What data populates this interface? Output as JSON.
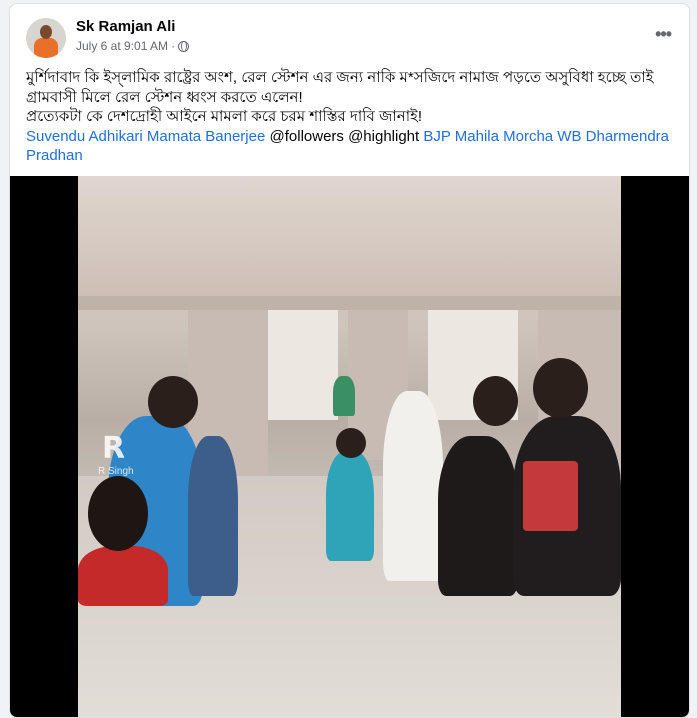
{
  "post": {
    "author": "Sk Ramjan Ali",
    "timestamp": "July 6 at 9:01 AM",
    "separator": "·",
    "privacy_icon": "globe-icon",
    "more_icon": "more-options-icon",
    "text_lines": [
      "মুর্শিদাবাদ কি ইস্‌লামিক রাষ্ট্রের অংশ,  রেল স্টেশন এর জন্য নাকি ম*সজিদে নামাজ পড়তে অসুবিধা হচ্ছে তাই গ্রামবাসী মিলে রেল স্টেশন ধ্বংস করতে এলেন!",
      "প্রত্যেকটা কে দেশদ্রোহী আইনে মামলা করে চরম শাস্তির দাবি জানাই!"
    ],
    "tags": {
      "t1": "Suvendu Adhikari",
      "t2": "Mamata Banerjee",
      "t3": "@followers @highlight",
      "t4": "BJP Mahila Morcha WB",
      "t5": "Dharmendra Pradhan"
    }
  },
  "video": {
    "watermark": "R",
    "watermark_sub": "R Singh"
  },
  "colors": {
    "link": "#216fdb",
    "text": "#050505",
    "muted": "#65676b"
  }
}
